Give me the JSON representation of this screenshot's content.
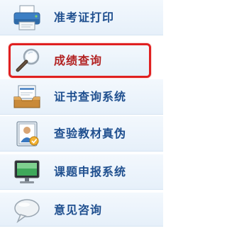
{
  "menu": {
    "items": [
      {
        "label": "准考证打印",
        "icon": "printer-icon"
      },
      {
        "label": "成绩查询",
        "icon": "magnifier-icon",
        "highlighted": true,
        "highlight_color": "#e02020"
      },
      {
        "label": "证书查询系统",
        "icon": "certificate-tray-icon"
      },
      {
        "label": "查验教材真伪",
        "icon": "textbook-verify-icon"
      },
      {
        "label": "课题申报系统",
        "icon": "monitor-icon"
      },
      {
        "label": "意见咨询",
        "icon": "speech-bubble-icon"
      }
    ]
  },
  "colors": {
    "label": "#1f4f8f",
    "highlight_label": "#b22222",
    "highlight_border": "#e02020",
    "background": "#e6f0fa"
  }
}
